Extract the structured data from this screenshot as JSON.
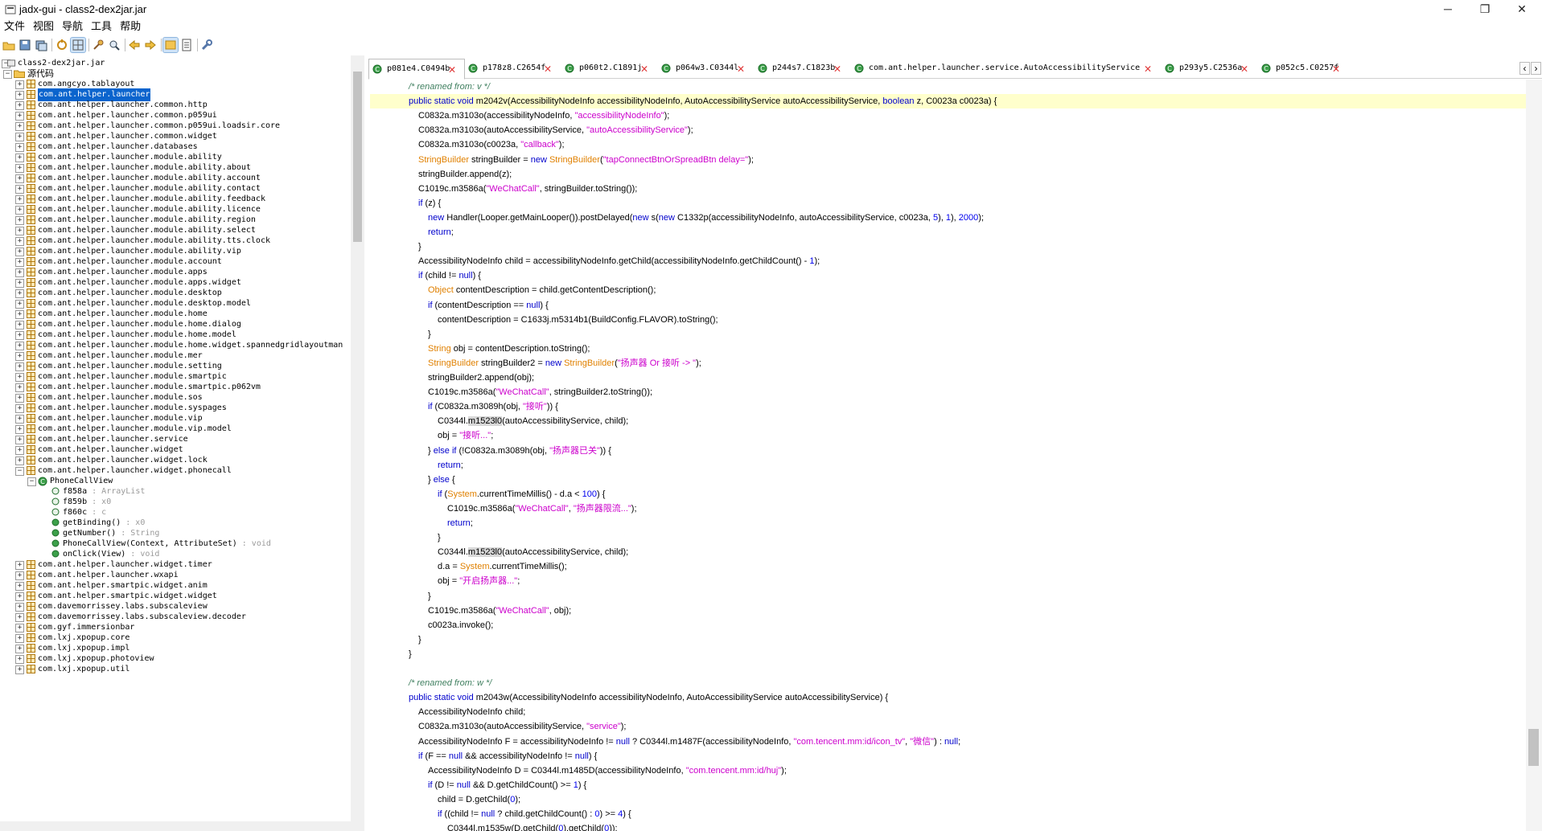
{
  "window": {
    "title": "jadx-gui - class2-dex2jar.jar",
    "controls": [
      "─",
      "❐",
      "✕"
    ]
  },
  "menu": [
    "文件",
    "视图",
    "导航",
    "工具",
    "帮助"
  ],
  "tree": {
    "root_label": "class2-dex2jar.jar",
    "source_label": "源代码",
    "packages": [
      "com.angcyo.tablayout",
      "com.ant.helper.launcher",
      "com.ant.helper.launcher.common.http",
      "com.ant.helper.launcher.common.p059ui",
      "com.ant.helper.launcher.common.p059ui.loadsir.core",
      "com.ant.helper.launcher.common.widget",
      "com.ant.helper.launcher.databases",
      "com.ant.helper.launcher.module.ability",
      "com.ant.helper.launcher.module.ability.about",
      "com.ant.helper.launcher.module.ability.account",
      "com.ant.helper.launcher.module.ability.contact",
      "com.ant.helper.launcher.module.ability.feedback",
      "com.ant.helper.launcher.module.ability.licence",
      "com.ant.helper.launcher.module.ability.region",
      "com.ant.helper.launcher.module.ability.select",
      "com.ant.helper.launcher.module.ability.tts.clock",
      "com.ant.helper.launcher.module.ability.vip",
      "com.ant.helper.launcher.module.account",
      "com.ant.helper.launcher.module.apps",
      "com.ant.helper.launcher.module.apps.widget",
      "com.ant.helper.launcher.module.desktop",
      "com.ant.helper.launcher.module.desktop.model",
      "com.ant.helper.launcher.module.home",
      "com.ant.helper.launcher.module.home.dialog",
      "com.ant.helper.launcher.module.home.model",
      "com.ant.helper.launcher.module.home.widget.spannedgridlayoutman",
      "com.ant.helper.launcher.module.mer",
      "com.ant.helper.launcher.module.setting",
      "com.ant.helper.launcher.module.smartpic",
      "com.ant.helper.launcher.module.smartpic.p062vm",
      "com.ant.helper.launcher.module.sos",
      "com.ant.helper.launcher.module.syspages",
      "com.ant.helper.launcher.module.vip",
      "com.ant.helper.launcher.module.vip.model",
      "com.ant.helper.launcher.service",
      "com.ant.helper.launcher.widget",
      "com.ant.helper.launcher.widget.lock",
      "com.ant.helper.launcher.widget.phonecall"
    ],
    "class_label": "PhoneCallView",
    "members": [
      {
        "name": "f858a",
        "type": " : ArrayList"
      },
      {
        "name": "f859b",
        "type": " : x0"
      },
      {
        "name": "f860c",
        "type": " : c"
      },
      {
        "name": "getBinding()",
        "type": " : x0"
      },
      {
        "name": "getNumber()",
        "type": " : String"
      },
      {
        "name": "PhoneCallView(Context, AttributeSet)",
        "type": " : void"
      },
      {
        "name": "onClick(View)",
        "type": " : void"
      }
    ],
    "packages_after": [
      "com.ant.helper.launcher.widget.timer",
      "com.ant.helper.launcher.wxapi",
      "com.ant.helper.smartpic.widget.anim",
      "com.ant.helper.smartpic.widget.widget",
      "com.davemorrissey.labs.subscaleview",
      "com.davemorrissey.labs.subscaleview.decoder",
      "com.gyf.immersionbar",
      "com.lxj.xpopup.core",
      "com.lxj.xpopup.impl",
      "com.lxj.xpopup.photoview",
      "com.lxj.xpopup.util"
    ]
  },
  "tabs": [
    "p081e4.C0494b",
    "p178z8.C2654f",
    "p060t2.C1891j",
    "p064w3.C0344l",
    "p244s7.C1823b",
    "com.ant.helper.launcher.service.AutoAccessibilityService",
    "p293y5.C2536a",
    "p052c5.C0257f"
  ],
  "code_lines": [
    {
      "i": 1,
      "h": "<span class=\"cmt\">/* renamed from: v */</span>"
    },
    {
      "i": 1,
      "h": "<span class=\"kw\">public static void</span> m2042v(AccessibilityNodeInfo accessibilityNodeInfo, AutoAccessibilityService autoAccessibilityService, <span class=\"kw\">boolean</span> z, C0023a c0023a) {",
      "hl": true
    },
    {
      "i": 2,
      "h": "C0832a.m3103o(accessibilityNodeInfo, <span class=\"str\">\"accessibilityNodeInfo\"</span>);"
    },
    {
      "i": 2,
      "h": "C0832a.m3103o(autoAccessibilityService, <span class=\"str\">\"autoAccessibilityService\"</span>);"
    },
    {
      "i": 2,
      "h": "C0832a.m3103o(c0023a, <span class=\"str\">\"callback\"</span>);"
    },
    {
      "i": 2,
      "h": "<span class=\"typ\">StringBuilder</span> stringBuilder = <span class=\"kw\">new</span> <span class=\"typ\">StringBuilder</span>(<span class=\"str\">\"tapConnectBtnOrSpreadBtn delay=\"</span>);"
    },
    {
      "i": 2,
      "h": "stringBuilder.append(z);"
    },
    {
      "i": 2,
      "h": "C1019c.m3586a(<span class=\"str\">\"WeChatCall\"</span>, stringBuilder.toString());"
    },
    {
      "i": 2,
      "h": "<span class=\"kw\">if</span> (z) {"
    },
    {
      "i": 3,
      "h": "<span class=\"kw\">new</span> Handler(Looper.getMainLooper()).postDelayed(<span class=\"kw\">new</span> s(<span class=\"kw\">new</span> C1332p(accessibilityNodeInfo, autoAccessibilityService, c0023a, <span class=\"num\">5</span>), <span class=\"num\">1</span>), <span class=\"num\">2000</span>);"
    },
    {
      "i": 3,
      "h": "<span class=\"kw\">return</span>;"
    },
    {
      "i": 2,
      "h": "}"
    },
    {
      "i": 2,
      "h": "AccessibilityNodeInfo child = accessibilityNodeInfo.getChild(accessibilityNodeInfo.getChildCount() - <span class=\"num\">1</span>);"
    },
    {
      "i": 2,
      "h": "<span class=\"kw\">if</span> (child != <span class=\"kw\">null</span>) {"
    },
    {
      "i": 3,
      "h": "<span class=\"typ\">Object</span> contentDescription = child.getContentDescription();"
    },
    {
      "i": 3,
      "h": "<span class=\"kw\">if</span> (contentDescription == <span class=\"kw\">null</span>) {"
    },
    {
      "i": 4,
      "h": "contentDescription = C1633j.m5314b1(BuildConfig.FLAVOR).toString();"
    },
    {
      "i": 3,
      "h": "}"
    },
    {
      "i": 3,
      "h": "<span class=\"typ\">String</span> obj = contentDescription.toString();"
    },
    {
      "i": 3,
      "h": "<span class=\"typ\">StringBuilder</span> stringBuilder2 = <span class=\"kw\">new</span> <span class=\"typ\">StringBuilder</span>(<span class=\"str\">\"扬声器 Or 接听 -> \"</span>);"
    },
    {
      "i": 3,
      "h": "stringBuilder2.append(obj);"
    },
    {
      "i": 3,
      "h": "C1019c.m3586a(<span class=\"str\">\"WeChatCall\"</span>, stringBuilder2.toString());"
    },
    {
      "i": 3,
      "h": "<span class=\"kw\">if</span> (C0832a.m3089h(obj, <span class=\"str\">\"接听\"</span>)) {"
    },
    {
      "i": 4,
      "h": "C0344l.<span class=\"mark\">m1523l0</span>(autoAccessibilityService, child);"
    },
    {
      "i": 4,
      "h": "obj = <span class=\"str\">\"接听...\"</span>;"
    },
    {
      "i": 3,
      "h": "} <span class=\"kw\">else if</span> (!C0832a.m3089h(obj, <span class=\"str\">\"扬声器已关\"</span>)) {"
    },
    {
      "i": 4,
      "h": "<span class=\"kw\">return</span>;"
    },
    {
      "i": 3,
      "h": "} <span class=\"kw\">else</span> {"
    },
    {
      "i": 4,
      "h": "<span class=\"kw\">if</span> (<span class=\"typ\">System</span>.currentTimeMillis() - d.a < <span class=\"num\">100</span>) {"
    },
    {
      "i": 5,
      "h": "C1019c.m3586a(<span class=\"str\">\"WeChatCall\"</span>, <span class=\"str\">\"扬声器限流...\"</span>);"
    },
    {
      "i": 5,
      "h": "<span class=\"kw\">return</span>;"
    },
    {
      "i": 4,
      "h": "}"
    },
    {
      "i": 4,
      "h": "C0344l.<span class=\"mark\">m1523l0</span>(autoAccessibilityService, child);"
    },
    {
      "i": 4,
      "h": "d.a = <span class=\"typ\">System</span>.currentTimeMillis();"
    },
    {
      "i": 4,
      "h": "obj = <span class=\"str\">\"开启扬声器...\"</span>;"
    },
    {
      "i": 3,
      "h": "}"
    },
    {
      "i": 3,
      "h": "C1019c.m3586a(<span class=\"str\">\"WeChatCall\"</span>, obj);"
    },
    {
      "i": 3,
      "h": "c0023a.invoke();"
    },
    {
      "i": 2,
      "h": "}"
    },
    {
      "i": 1,
      "h": "}"
    },
    {
      "i": 1,
      "h": ""
    },
    {
      "i": 1,
      "h": "<span class=\"cmt\">/* renamed from: w */</span>"
    },
    {
      "i": 1,
      "h": "<span class=\"kw\">public static void</span> m2043w(AccessibilityNodeInfo accessibilityNodeInfo, AutoAccessibilityService autoAccessibilityService) {"
    },
    {
      "i": 2,
      "h": "AccessibilityNodeInfo child;"
    },
    {
      "i": 2,
      "h": "C0832a.m3103o(autoAccessibilityService, <span class=\"str\">\"service\"</span>);"
    },
    {
      "i": 2,
      "h": "AccessibilityNodeInfo F = accessibilityNodeInfo != <span class=\"kw\">null</span> ? C0344l.m1487F(accessibilityNodeInfo, <span class=\"str\">\"com.tencent.mm:id/icon_tv\"</span>, <span class=\"str\">\"微信\"</span>) : <span class=\"kw\">null</span>;"
    },
    {
      "i": 2,
      "h": "<span class=\"kw\">if</span> (F == <span class=\"kw\">null</span> && accessibilityNodeInfo != <span class=\"kw\">null</span>) {"
    },
    {
      "i": 3,
      "h": "AccessibilityNodeInfo D = C0344l.m1485D(accessibilityNodeInfo, <span class=\"str\">\"com.tencent.mm:id/huj\"</span>);"
    },
    {
      "i": 3,
      "h": "<span class=\"kw\">if</span> (D != <span class=\"kw\">null</span> && D.getChildCount() >= <span class=\"num\">1</span>) {"
    },
    {
      "i": 4,
      "h": "child = D.getChild(<span class=\"num\">0</span>);"
    },
    {
      "i": 4,
      "h": "<span class=\"kw\">if</span> ((child != <span class=\"kw\">null</span> ? child.getChildCount() : <span class=\"num\">0</span>) >= <span class=\"num\">4</span>) {"
    },
    {
      "i": 5,
      "h": "C0344l.m1535w(D.getChild(<span class=\"num\">0</span>).getChild(<span class=\"num\">0</span>));"
    }
  ]
}
